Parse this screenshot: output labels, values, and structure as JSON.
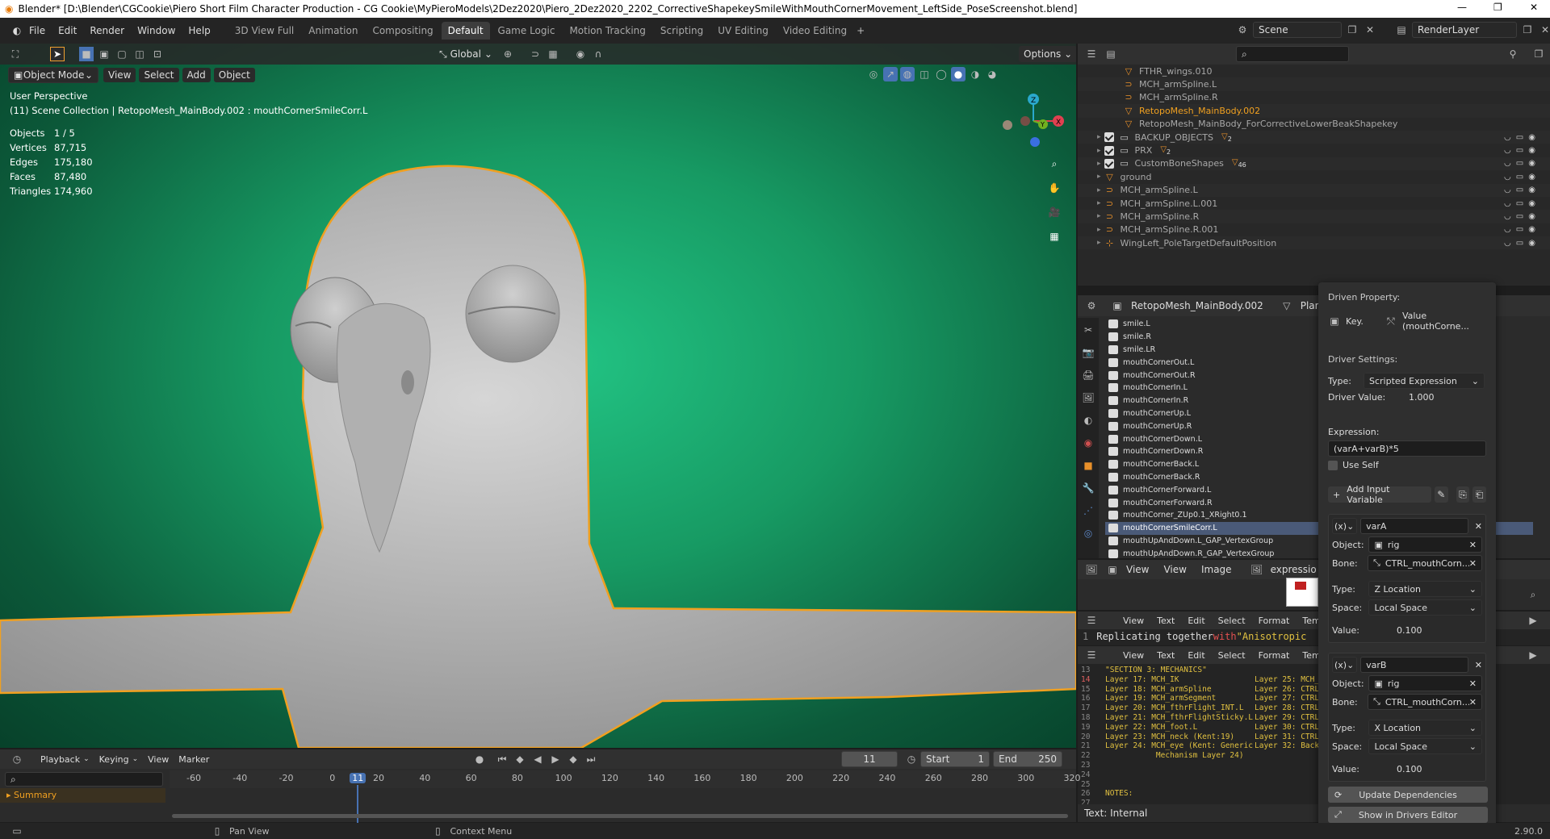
{
  "titlebar": {
    "title": "Blender* [D:\\Blender\\CGCookie\\Piero Short Film Character Production - CG Cookie\\MyPieroModels\\2Dez2020\\Piero_2Dez2020_2202_CorrectiveShapekeySmileWithMouthCornerMovement_LeftSide_PoseScreenshot.blend]"
  },
  "menubar": {
    "items": [
      "File",
      "Edit",
      "Render",
      "Window",
      "Help"
    ],
    "workspaces": [
      "3D View Full",
      "Animation",
      "Compositing",
      "Default",
      "Game Logic",
      "Motion Tracking",
      "Scripting",
      "UV Editing",
      "Video Editing"
    ],
    "active_workspace": "Default",
    "scene": "Scene",
    "render_layer": "RenderLayer"
  },
  "viewport_toolbar": {
    "transform": "Global",
    "options": "Options",
    "mode": "Object Mode",
    "menus": [
      "View",
      "Select",
      "Add",
      "Object"
    ]
  },
  "viewport": {
    "perspective": "User Perspective",
    "collection": "(11) Scene Collection | RetopoMesh_MainBody.002 : mouthCornerSmileCorr.L",
    "stats": [
      [
        "Objects",
        "1 / 5"
      ],
      [
        "Vertices",
        "87,715"
      ],
      [
        "Edges",
        "175,180"
      ],
      [
        "Faces",
        "87,480"
      ],
      [
        "Triangles",
        "174,960"
      ]
    ],
    "bg_color": "#1fb378"
  },
  "outliner": {
    "items": [
      {
        "name": "FTHR_wings.010",
        "indent": 3,
        "type": "mesh"
      },
      {
        "name": "MCH_armSpline.L",
        "indent": 3,
        "type": "curve"
      },
      {
        "name": "MCH_armSpline.R",
        "indent": 3,
        "type": "curve"
      },
      {
        "name": "RetopoMesh_MainBody.002",
        "indent": 3,
        "type": "mesh",
        "active": true
      },
      {
        "name": "RetopoMesh_MainBody_ForCorrectiveLowerBeakShapekey",
        "indent": 3,
        "type": "mesh"
      },
      {
        "name": "BACKUP_OBJECTS",
        "indent": 1,
        "type": "collection",
        "badge": "2"
      },
      {
        "name": "PRX",
        "indent": 1,
        "type": "collection",
        "badge": "2"
      },
      {
        "name": "CustomBoneShapes",
        "indent": 1,
        "type": "collection",
        "badge": "46"
      },
      {
        "name": "ground",
        "indent": 1,
        "type": "mesh"
      },
      {
        "name": "MCH_armSpline.L",
        "indent": 1,
        "type": "curve"
      },
      {
        "name": "MCH_armSpline.L.001",
        "indent": 1,
        "type": "curve"
      },
      {
        "name": "MCH_armSpline.R",
        "indent": 1,
        "type": "curve"
      },
      {
        "name": "MCH_armSpline.R.001",
        "indent": 1,
        "type": "curve"
      },
      {
        "name": "WingLeft_PoleTargetDefaultPosition",
        "indent": 1,
        "type": "empty"
      }
    ]
  },
  "properties": {
    "object": "RetopoMesh_MainBody.002",
    "mesh": "Plane.",
    "shapekeys": [
      "smile.L",
      "smile.R",
      "smile.LR",
      "mouthCornerOut.L",
      "mouthCornerOut.R",
      "mouthCornerIn.L",
      "mouthCornerIn.R",
      "mouthCornerUp.L",
      "mouthCornerUp.R",
      "mouthCornerDown.L",
      "mouthCornerDown.R",
      "mouthCornerBack.L",
      "mouthCornerBack.R",
      "mouthCornerForward.L",
      "mouthCornerForward.R",
      "mouthCorner_ZUp0.1_XRight0.1",
      "mouthCornerSmileCorr.L",
      "mouthUpAndDown.L_GAP_VertexGroup",
      "mouthUpAndDown.R_GAP_VertexGroup"
    ],
    "active_shapekey": "mouthCornerSmileCorr.L"
  },
  "image_editor": {
    "menus": [
      "View",
      "View",
      "Image"
    ],
    "image_name": "expressio"
  },
  "text_editor1": {
    "menus": [
      "View",
      "Text",
      "Edit",
      "Select",
      "Format",
      "Templat"
    ],
    "line_no": "1",
    "line_pre": "Replicating together ",
    "line_kw": "with",
    "line_post": " \"Anisotropic"
  },
  "text_editor2": {
    "menus": [
      "View",
      "Text",
      "Edit",
      "Select",
      "Format",
      "Templat"
    ],
    "line_numbers": [
      "13",
      "14",
      "15",
      "16",
      "17",
      "18",
      "19",
      "20",
      "21",
      "22",
      "23",
      "24",
      "25",
      "26",
      "27"
    ],
    "lines": [
      "\"SECTION 3: MECHANICS\"",
      "Layer 17: MCH_IK",
      "Layer 18: MCH_armSpline",
      "Layer 19: MCH_armSegment",
      "Layer 20: MCH_fthrFlight_INT.L",
      "Layer 21: MCH_fthrFlightSticky.L",
      "Layer 22: MCH_foot.L",
      "Layer 23: MCH_neck (Kent:19)",
      "Layer 24: MCH_eye (Kent: Generic",
      "           Mechanism Layer 24)",
      "",
      "",
      "",
      "NOTES:",
      ""
    ],
    "right_col": [
      "",
      "Layer 25: MCH_E",
      "Layer 26: CTRL_",
      "Layer 27: CTRL_",
      "Layer 28: CTRL_",
      "Layer 29: CTRL_",
      "Layer 30: CTRL_",
      "Layer 31: CTRL_",
      "Layer 32: Backu",
      "",
      "",
      "",
      "",
      "",
      ""
    ],
    "status": "Text: Internal"
  },
  "driver": {
    "driven_property": "Driven Property:",
    "key_label": "Key.",
    "value_label": "Value (mouthCorne...",
    "settings_label": "Driver Settings:",
    "type_label": "Type:",
    "type_value": "Scripted Expression",
    "driver_value_label": "Driver Value:",
    "driver_value": "1.000",
    "expression_label": "Expression:",
    "expression": "(varA+varB)*5",
    "use_self": "Use Self",
    "add_variable": "Add Input Variable",
    "variables": [
      {
        "name": "varA",
        "object_label": "Object:",
        "object": "rig",
        "bone_label": "Bone:",
        "bone": "CTRL_mouthCorn...",
        "type_label": "Type:",
        "type": "Z Location",
        "space_label": "Space:",
        "space": "Local Space",
        "value_label": "Value:",
        "value": "0.100"
      },
      {
        "name": "varB",
        "object_label": "Object:",
        "object": "rig",
        "bone_label": "Bone:",
        "bone": "CTRL_mouthCorn...",
        "type_label": "Type:",
        "type": "X Location",
        "space_label": "Space:",
        "space": "Local Space",
        "value_label": "Value:",
        "value": "0.100"
      }
    ],
    "update": "Update Dependencies",
    "show_in_editor": "Show in Drivers Editor"
  },
  "timeline": {
    "menus": [
      "Playback",
      "Keying",
      "View",
      "Marker"
    ],
    "current_frame": "11",
    "start_label": "Start",
    "start": "1",
    "end_label": "End",
    "end": "250",
    "ruler": [
      "-60",
      "-40",
      "-20",
      "0",
      "11",
      "20",
      "40",
      "60",
      "80",
      "100",
      "120",
      "140",
      "160",
      "180",
      "200",
      "220",
      "240",
      "260",
      "280",
      "300",
      "320"
    ],
    "summary": "Summary"
  },
  "statusbar": {
    "pan": "Pan View",
    "context": "Context Menu",
    "version": "2.90.0"
  }
}
